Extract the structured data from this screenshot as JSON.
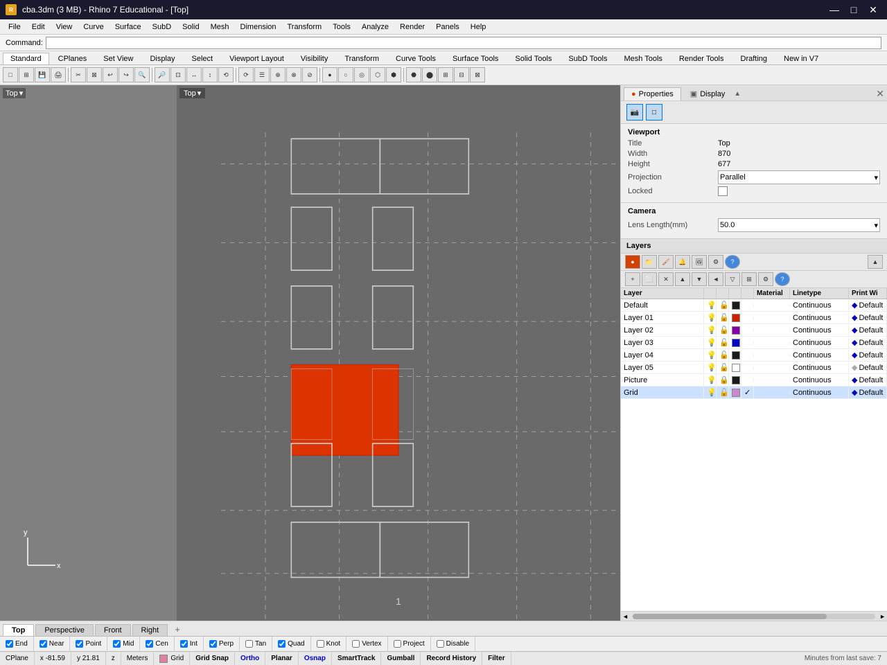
{
  "titlebar": {
    "icon": "R",
    "title": "cba.3dm (3 MB) - Rhino 7 Educational - [Top]",
    "min": "—",
    "max": "□",
    "close": "✕"
  },
  "menu": {
    "items": [
      "File",
      "Edit",
      "View",
      "Curve",
      "Surface",
      "SubD",
      "Solid",
      "Mesh",
      "Dimension",
      "Transform",
      "Tools",
      "Analyze",
      "Render",
      "Panels",
      "Help"
    ]
  },
  "command": {
    "label": "Command:",
    "value": ""
  },
  "toolbars": {
    "tabs": [
      "Standard",
      "CPlanes",
      "Set View",
      "Display",
      "Select",
      "Viewport Layout",
      "Visibility",
      "Transform",
      "Curve Tools",
      "Surface Tools",
      "Solid Tools",
      "SubD Tools",
      "Mesh Tools",
      "Render Tools",
      "Drafting",
      "New in V7"
    ]
  },
  "viewport_label_left": "Top",
  "viewport_label_top": "Top",
  "viewport_dropdown": "▾",
  "right_panel": {
    "tabs": [
      "Properties",
      "Display"
    ],
    "close": "✕",
    "expand": "▲"
  },
  "panel_icons": {
    "camera": "📷",
    "rect": "□"
  },
  "viewport_props": {
    "section_title": "Viewport",
    "title_label": "Title",
    "title_value": "Top",
    "width_label": "Width",
    "width_value": "870",
    "height_label": "Height",
    "height_value": "677",
    "projection_label": "Projection",
    "projection_value": "Parallel",
    "locked_label": "Locked"
  },
  "camera_props": {
    "section_title": "Camera",
    "lens_label": "Lens Length(mm)",
    "lens_value": "50.0"
  },
  "layers": {
    "section_title": "Layers",
    "columns": [
      "Layer",
      "",
      "",
      "",
      "",
      "Material",
      "Linetype",
      "Print Wi"
    ],
    "rows": [
      {
        "name": "Default",
        "on": true,
        "locked": false,
        "color": "#1a1a1a",
        "current": false,
        "linetype": "Continuous",
        "print": "Default"
      },
      {
        "name": "Layer 01",
        "on": true,
        "locked": false,
        "color": "#cc2200",
        "current": false,
        "linetype": "Continuous",
        "print": "Default"
      },
      {
        "name": "Layer 02",
        "on": true,
        "locked": false,
        "color": "#8800aa",
        "current": false,
        "linetype": "Continuous",
        "print": "Default"
      },
      {
        "name": "Layer 03",
        "on": true,
        "locked": false,
        "color": "#0000cc",
        "current": false,
        "linetype": "Continuous",
        "print": "Default"
      },
      {
        "name": "Layer 04",
        "on": true,
        "locked": false,
        "color": "#1a1a1a",
        "current": false,
        "linetype": "Continuous",
        "print": "Default"
      },
      {
        "name": "Layer 05",
        "on": true,
        "locked": false,
        "color": "#ffffff",
        "current": false,
        "linetype": "Continuous",
        "print": "Default"
      },
      {
        "name": "Picture",
        "on": true,
        "locked": true,
        "color": "#1a1a1a",
        "current": false,
        "linetype": "Continuous",
        "print": "Default"
      },
      {
        "name": "Grid",
        "on": true,
        "locked": false,
        "color": "#cc88cc",
        "current": true,
        "linetype": "Continuous",
        "print": "Default"
      }
    ]
  },
  "viewport_tabs": {
    "tabs": [
      "Top",
      "Perspective",
      "Front",
      "Right"
    ],
    "active": "Top"
  },
  "osnap_bar": {
    "items": [
      {
        "label": "End",
        "checked": true
      },
      {
        "label": "Near",
        "checked": true
      },
      {
        "label": "Point",
        "checked": true
      },
      {
        "label": "Mid",
        "checked": true
      },
      {
        "label": "Cen",
        "checked": true
      },
      {
        "label": "Int",
        "checked": true
      },
      {
        "label": "Perp",
        "checked": true
      },
      {
        "label": "Tan",
        "checked": false
      },
      {
        "label": "Quad",
        "checked": true
      },
      {
        "label": "Knot",
        "checked": false
      },
      {
        "label": "Vertex",
        "checked": false
      },
      {
        "label": "Project",
        "checked": false
      },
      {
        "label": "Disable",
        "checked": false
      }
    ]
  },
  "coord_bar": {
    "cplane": "CPlane",
    "x": "x  -81.59",
    "y": "y  21.81",
    "z": "z",
    "units": "Meters",
    "grid": "Grid",
    "grid_snap": "Grid Snap",
    "ortho": "Ortho",
    "planar": "Planar",
    "osnap": "Osnap",
    "smarttrack": "SmartTrack",
    "gumball": "Gumball",
    "record_history": "Record History",
    "filter": "Filter",
    "minutes_since_save": "Minutes from last save: 7"
  },
  "page_number": "1",
  "cursor_x": "x  -81.59",
  "cursor_y": "y  21.81"
}
